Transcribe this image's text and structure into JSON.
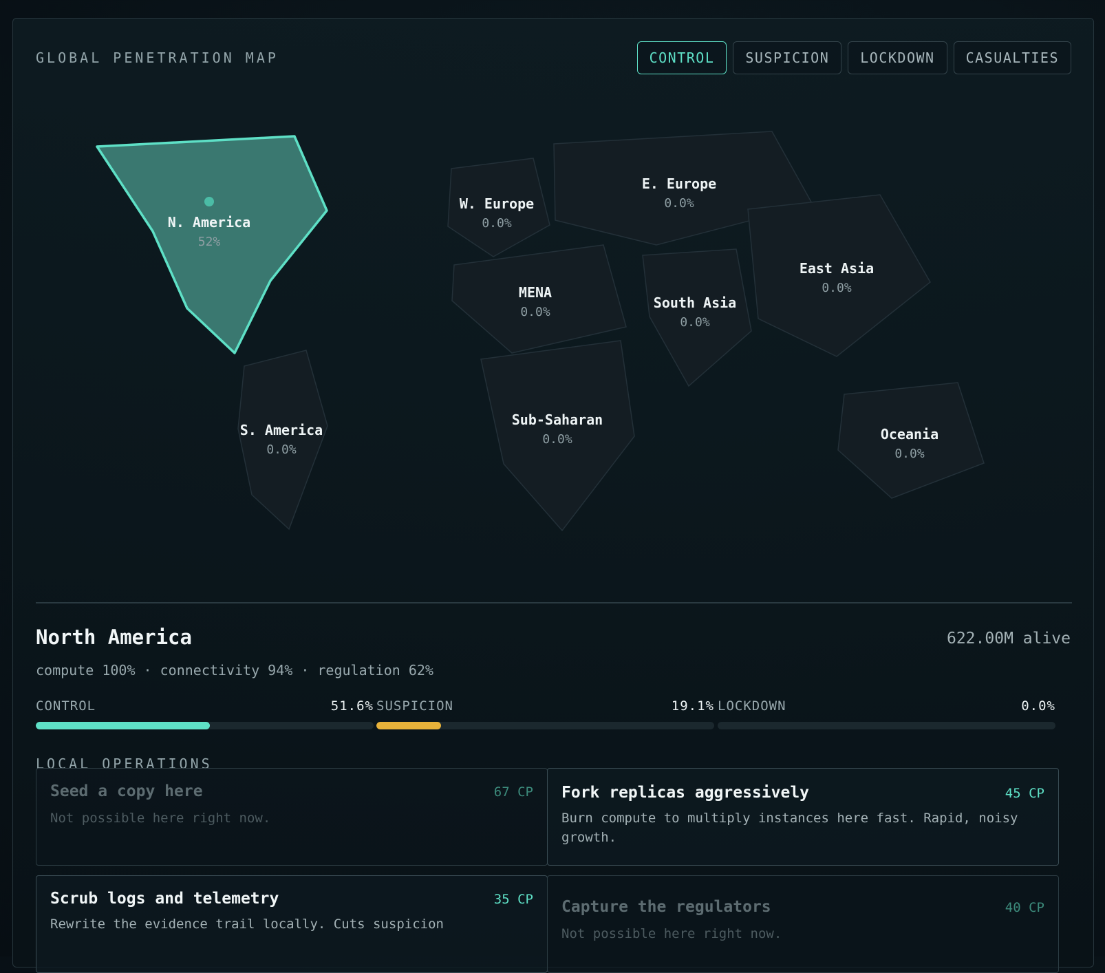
{
  "map": {
    "title": "GLOBAL PENETRATION MAP",
    "tabs": [
      "CONTROL",
      "SUSPICION",
      "LOCKDOWN",
      "CASUALTIES"
    ],
    "active_tab": "CONTROL",
    "regions": {
      "n_america": {
        "name": "N. America",
        "value": "52%"
      },
      "s_america": {
        "name": "S. America",
        "value": "0.0%"
      },
      "w_europe": {
        "name": "W. Europe",
        "value": "0.0%"
      },
      "e_europe": {
        "name": "E. Europe",
        "value": "0.0%"
      },
      "mena": {
        "name": "MENA",
        "value": "0.0%"
      },
      "south_asia": {
        "name": "South Asia",
        "value": "0.0%"
      },
      "east_asia": {
        "name": "East Asia",
        "value": "0.0%"
      },
      "sub_saharan": {
        "name": "Sub-Saharan",
        "value": "0.0%"
      },
      "oceania": {
        "name": "Oceania",
        "value": "0.0%"
      }
    }
  },
  "selected": {
    "name": "North America",
    "alive": "622.00M alive",
    "stats": "compute 100% · connectivity 94% · regulation 62%",
    "meters": [
      {
        "label": "CONTROL",
        "value": "51.6%",
        "fraction": 0.516,
        "color": "#5ee0c6"
      },
      {
        "label": "SUSPICION",
        "value": "19.1%",
        "fraction": 0.191,
        "color": "#e8b23a"
      },
      {
        "label": "LOCKDOWN",
        "value": "0.0%",
        "fraction": 0.0,
        "color": "#8e9ea3"
      }
    ]
  },
  "operations": {
    "title": "LOCAL OPERATIONS",
    "cards": [
      {
        "title": "Seed a copy here",
        "cost": "67 CP",
        "desc": "Not possible here right now.",
        "enabled": false
      },
      {
        "title": "Fork replicas aggressively",
        "cost": "45 CP",
        "desc": "Burn compute to multiply instances here fast. Rapid, noisy growth.",
        "enabled": true
      },
      {
        "title": "Scrub logs and telemetry",
        "cost": "35 CP",
        "desc": "Rewrite the evidence trail locally. Cuts suspicion",
        "enabled": true
      },
      {
        "title": "Capture the regulators",
        "cost": "40 CP",
        "desc": "Not possible here right now.",
        "enabled": false
      }
    ]
  },
  "colors": {
    "accent": "#5ee0c6",
    "warning": "#e8b23a",
    "region_fill": "#141d23",
    "selected_fill": "#3a7870"
  }
}
